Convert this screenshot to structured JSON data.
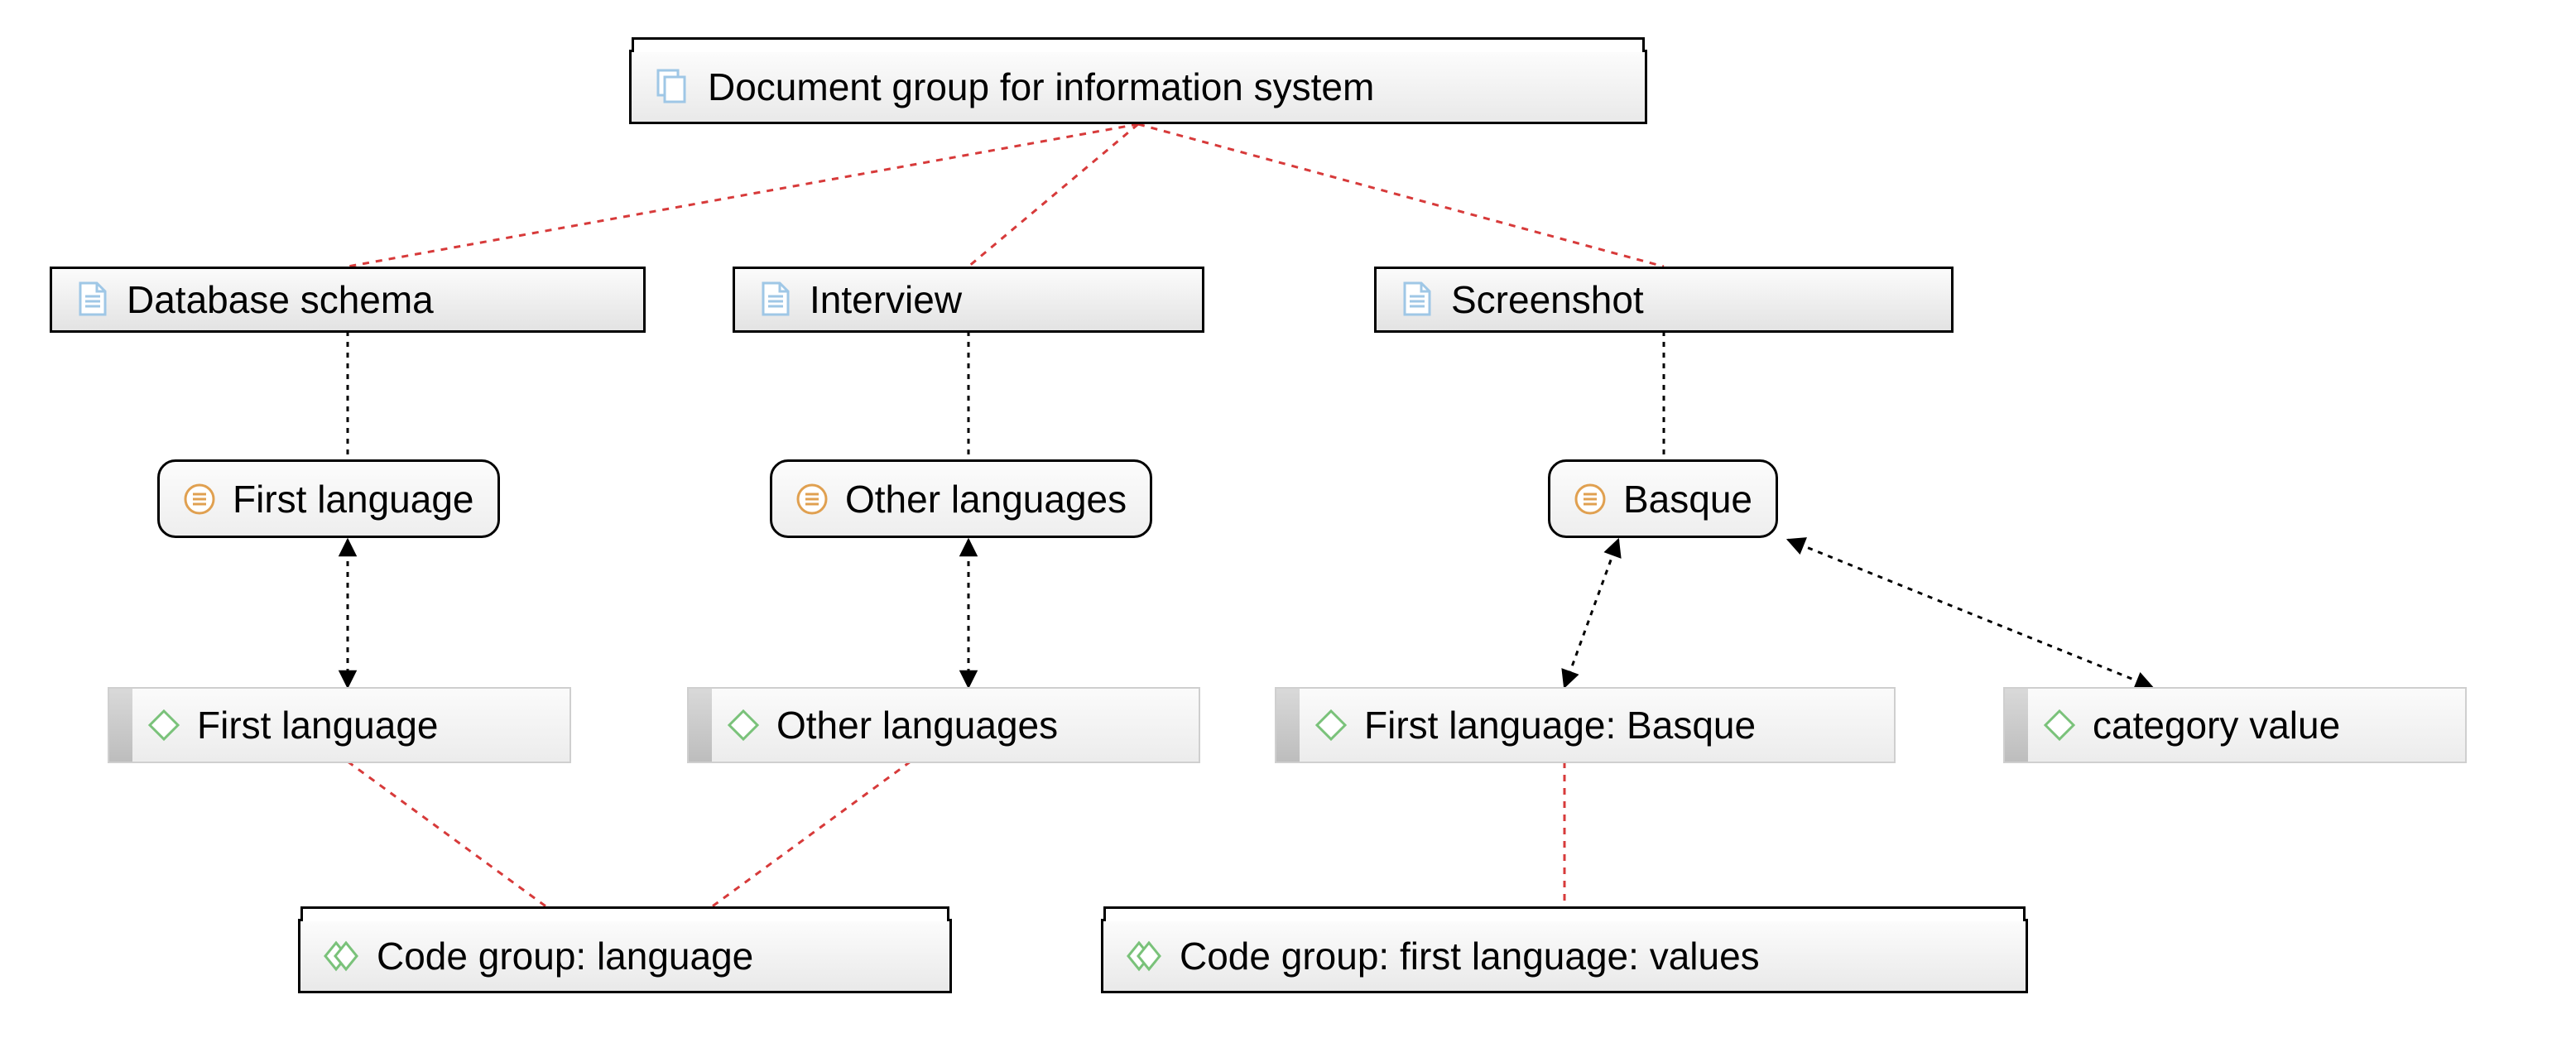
{
  "nodes": {
    "root": {
      "label": "Document group for information system"
    },
    "db_schema": {
      "label": "Database schema"
    },
    "interview": {
      "label": "Interview"
    },
    "screenshot": {
      "label": "Screenshot"
    },
    "first_lang_q": {
      "label": "First language"
    },
    "other_lang_q": {
      "label": "Other languages"
    },
    "basque_q": {
      "label": "Basque"
    },
    "first_lang_c": {
      "label": "First language"
    },
    "other_lang_c": {
      "label": "Other languages"
    },
    "first_basque_c": {
      "label": "First language: Basque"
    },
    "cat_value_c": {
      "label": "category value"
    },
    "cg_language": {
      "label": "Code group: language"
    },
    "cg_first_vals": {
      "label": "Code group: first language: values"
    }
  },
  "edges": [
    {
      "from": "root",
      "to": "db_schema",
      "style": "red-dash"
    },
    {
      "from": "root",
      "to": "interview",
      "style": "red-dash"
    },
    {
      "from": "root",
      "to": "screenshot",
      "style": "red-dash"
    },
    {
      "from": "db_schema",
      "to": "first_lang_q",
      "style": "black-dash"
    },
    {
      "from": "interview",
      "to": "other_lang_q",
      "style": "black-dash"
    },
    {
      "from": "screenshot",
      "to": "basque_q",
      "style": "black-dash"
    },
    {
      "from": "first_lang_q",
      "to": "first_lang_c",
      "style": "black-dash-double-arrow"
    },
    {
      "from": "other_lang_q",
      "to": "other_lang_c",
      "style": "black-dash-double-arrow"
    },
    {
      "from": "basque_q",
      "to": "first_basque_c",
      "style": "black-dash-double-arrow"
    },
    {
      "from": "basque_q",
      "to": "cat_value_c",
      "style": "black-dash-double-arrow"
    },
    {
      "from": "first_lang_c",
      "to": "cg_language",
      "style": "red-dash"
    },
    {
      "from": "other_lang_c",
      "to": "cg_language",
      "style": "red-dash"
    },
    {
      "from": "first_basque_c",
      "to": "cg_first_vals",
      "style": "red-dash"
    }
  ],
  "colors": {
    "red": "#d73a3a",
    "code_green": "#7ac27a",
    "quote_orange": "#e0a050",
    "doc_blue": "#9fc7e6"
  }
}
